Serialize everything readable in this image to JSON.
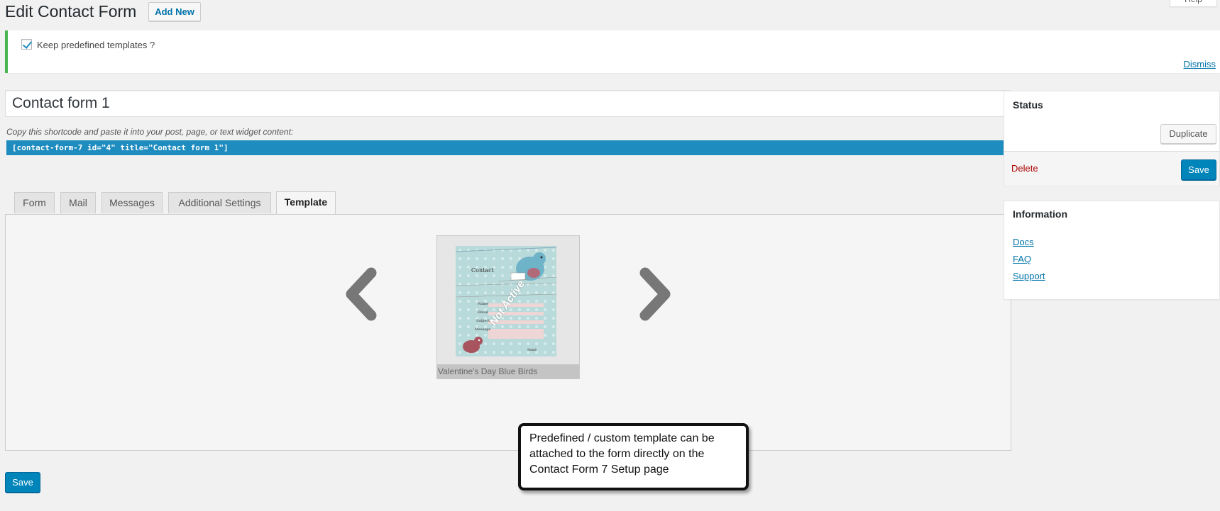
{
  "header": {
    "title": "Edit Contact Form",
    "add_new_label": "Add New",
    "help_label": "Help"
  },
  "notice": {
    "checkbox_label": "Keep predefined templates ?",
    "checked": true,
    "dismiss_label": "Dismiss"
  },
  "form": {
    "title_value": "Contact form 1",
    "shortcode_hint": "Copy this shortcode and paste it into your post, page, or text widget content:",
    "shortcode": "[contact-form-7 id=\"4\" title=\"Contact form 1\"]"
  },
  "tabs": [
    {
      "label": "Form",
      "active": false
    },
    {
      "label": "Mail",
      "active": false
    },
    {
      "label": "Messages",
      "active": false
    },
    {
      "label": "Additional Settings",
      "active": false
    },
    {
      "label": "Template",
      "active": true
    }
  ],
  "template": {
    "name": "Valentine's Day Blue Birds",
    "status_overlay": "Not Active",
    "preview_heading": "Contact",
    "preview_fields": [
      "Name",
      "Email",
      "Subject",
      "Message"
    ],
    "preview_button": "Send",
    "prev_icon": "chevron-left-icon",
    "next_icon": "chevron-right-icon"
  },
  "callout": {
    "text": "Predefined / custom template can be attached to the form directly on the Contact Form 7 Setup page"
  },
  "bottom": {
    "save_label": "Save"
  },
  "sidebar": {
    "status": {
      "title": "Status",
      "duplicate_label": "Duplicate",
      "delete_label": "Delete",
      "save_label": "Save"
    },
    "information": {
      "title": "Information",
      "links": [
        "Docs",
        "FAQ",
        "Support"
      ]
    }
  },
  "colors": {
    "accent": "#0085ba",
    "shortcode_bg": "#1e8cbe",
    "notice_border": "#46b450",
    "delete": "#aa0000"
  }
}
